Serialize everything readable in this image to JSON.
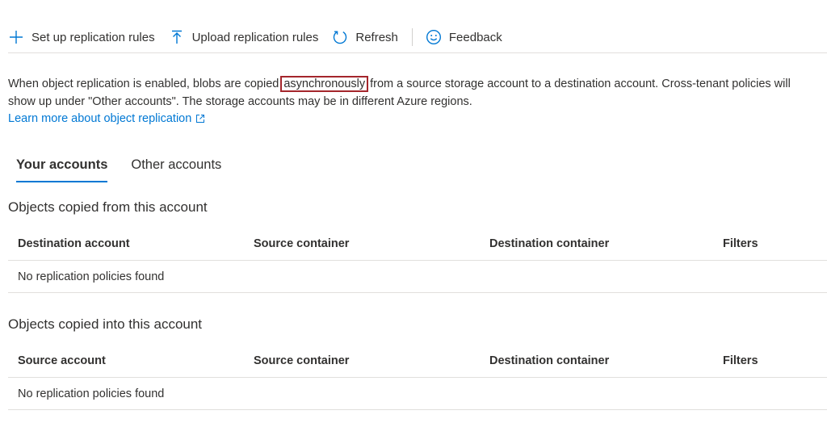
{
  "toolbar": {
    "setup_label": "Set up replication rules",
    "upload_label": "Upload replication rules",
    "refresh_label": "Refresh",
    "feedback_label": "Feedback"
  },
  "description": {
    "before": "When object replication is enabled, blobs are copied ",
    "highlight": "asynchronously",
    "after": " from a source storage account to a destination account. Cross-tenant policies will show up under \"Other accounts\". The storage accounts may be in different Azure regions."
  },
  "learn_more": "Learn more about object replication",
  "tabs": [
    {
      "label": "Your accounts",
      "active": true
    },
    {
      "label": "Other accounts",
      "active": false
    }
  ],
  "sections": {
    "from": {
      "title": "Objects copied from this account",
      "columns": [
        "Destination account",
        "Source container",
        "Destination container",
        "Filters"
      ],
      "empty": "No replication policies found"
    },
    "into": {
      "title": "Objects copied into this account",
      "columns": [
        "Source account",
        "Source container",
        "Destination container",
        "Filters"
      ],
      "empty": "No replication policies found"
    }
  },
  "colors": {
    "accent": "#0078d4",
    "highlight_border": "#a4262c",
    "text": "#323130",
    "divider": "#e1dfdd"
  }
}
